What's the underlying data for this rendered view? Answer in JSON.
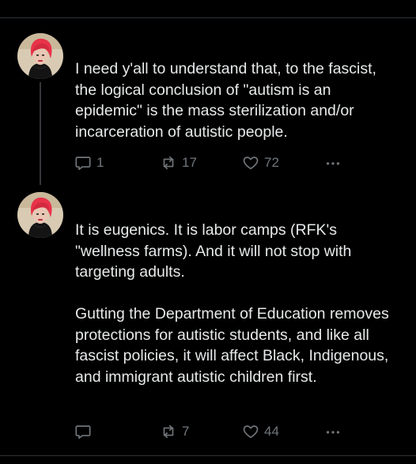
{
  "thread": {
    "posts": [
      {
        "paragraphs": [
          "I need y'all to understand that, to the fascist, the logical conclusion of \"autism is an epidemic\" is the mass sterilization and/or incarceration of autistic people."
        ],
        "actions": {
          "replies": "1",
          "reposts": "17",
          "likes": "72"
        }
      },
      {
        "paragraphs": [
          "It is eugenics. It is labor camps (RFK's \"wellness farms). And it will not stop with targeting adults.",
          "Gutting the Department of Education removes protections for autistic students, and like all fascist policies, it will affect Black, Indigenous, and immigrant autistic children first."
        ],
        "actions": {
          "replies": "",
          "reposts": "7",
          "likes": "44"
        }
      }
    ]
  },
  "icons": {
    "reply": "reply-icon",
    "repost": "repost-icon",
    "like": "heart-icon",
    "more": "more-icon"
  },
  "colors": {
    "background": "#000000",
    "text": "#e7e9ea",
    "muted": "#71767b",
    "divider": "#2f3336",
    "avatar_hair": "#e8334a"
  }
}
